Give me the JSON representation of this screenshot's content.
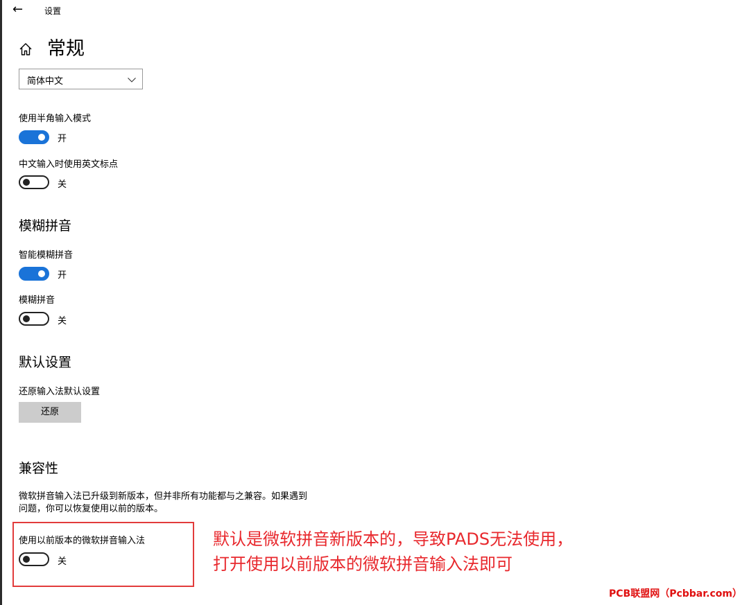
{
  "window": {
    "back_icon": "arrow-left-icon",
    "app_title": "设置"
  },
  "page": {
    "icon": "home-icon",
    "title": "常规"
  },
  "language_dropdown": {
    "value": "简体中文"
  },
  "settings": {
    "half_width": {
      "label": "使用半角输入模式",
      "state": "开",
      "on": true
    },
    "english_punct": {
      "label": "中文输入时使用英文标点",
      "state": "关",
      "on": false
    }
  },
  "fuzzy": {
    "heading": "模糊拼音",
    "smart": {
      "label": "智能模糊拼音",
      "state": "开",
      "on": true
    },
    "fuzzy_pinyin": {
      "label": "模糊拼音",
      "state": "关",
      "on": false
    }
  },
  "defaults": {
    "heading": "默认设置",
    "label": "还原输入法默认设置",
    "restore_button": "还原"
  },
  "compat": {
    "heading": "兼容性",
    "desc_line1": "微软拼音输入法已升级到新版本，但并非所有功能都与之兼容。如果遇到",
    "desc_line2": "问题，你可以恢复使用以前的版本。",
    "legacy": {
      "label": "使用以前版本的微软拼音输入法",
      "state": "关",
      "on": false
    }
  },
  "annotation": {
    "line1": "默认是微软拼音新版本的，导致PADS无法使用，",
    "line2": "打开使用以前版本的微软拼音输入法即可",
    "color": "#e8282d"
  },
  "watermark": "PCB联盟网（Pcbbar.com）",
  "colors": {
    "accent": "#1a73d8",
    "button_bg": "#cccccc"
  }
}
